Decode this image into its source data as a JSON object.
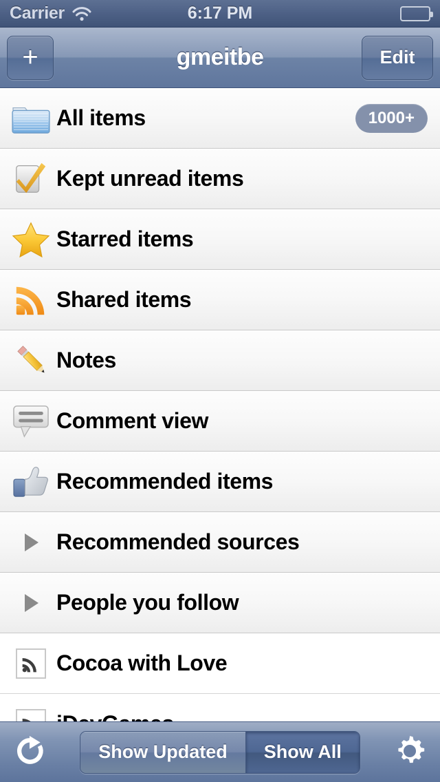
{
  "status_bar": {
    "carrier": "Carrier",
    "wifi_icon": "wifi-icon",
    "time": "6:17 PM",
    "battery_icon": "battery-icon"
  },
  "nav_bar": {
    "add_label": "+",
    "title": "gmeitbe",
    "edit_label": "Edit"
  },
  "list": {
    "rows": [
      {
        "label": "All items",
        "icon": "folder-icon",
        "badge": "1000+",
        "style": "grouped"
      },
      {
        "label": "Kept unread items",
        "icon": "checkmark-icon",
        "badge": "",
        "style": "grouped"
      },
      {
        "label": "Starred items",
        "icon": "star-icon",
        "badge": "",
        "style": "grouped"
      },
      {
        "label": "Shared items",
        "icon": "rss-icon",
        "badge": "",
        "style": "grouped"
      },
      {
        "label": "Notes",
        "icon": "pencil-icon",
        "badge": "",
        "style": "grouped"
      },
      {
        "label": "Comment view",
        "icon": "comment-icon",
        "badge": "",
        "style": "grouped"
      },
      {
        "label": "Recommended items",
        "icon": "thumbs-up-icon",
        "badge": "",
        "style": "grouped"
      },
      {
        "label": "Recommended sources",
        "icon": "disclosure-triangle-icon",
        "badge": "",
        "style": "grouped"
      },
      {
        "label": "People you follow",
        "icon": "disclosure-triangle-icon",
        "badge": "",
        "style": "grouped"
      },
      {
        "label": "Cocoa with Love",
        "icon": "feed-favicon",
        "badge": "",
        "style": "plain"
      },
      {
        "label": "iDevGames",
        "icon": "feed-favicon",
        "badge": "",
        "style": "plain"
      }
    ]
  },
  "toolbar": {
    "refresh_icon": "refresh-icon",
    "segments": [
      {
        "label": "Show Updated",
        "selected": false
      },
      {
        "label": "Show All",
        "selected": true
      }
    ],
    "settings_icon": "gear-icon"
  },
  "colors": {
    "nav_bar_blue": "#6d83a6",
    "status_bar_blue": "#4f6287",
    "badge_gray_blue": "#8491ab",
    "selected_segment": "#4e6793",
    "star_gold": "#f5c33b",
    "rss_orange": "#f59120",
    "folder_blue": "#8fbde8",
    "row_text": "#000000"
  }
}
